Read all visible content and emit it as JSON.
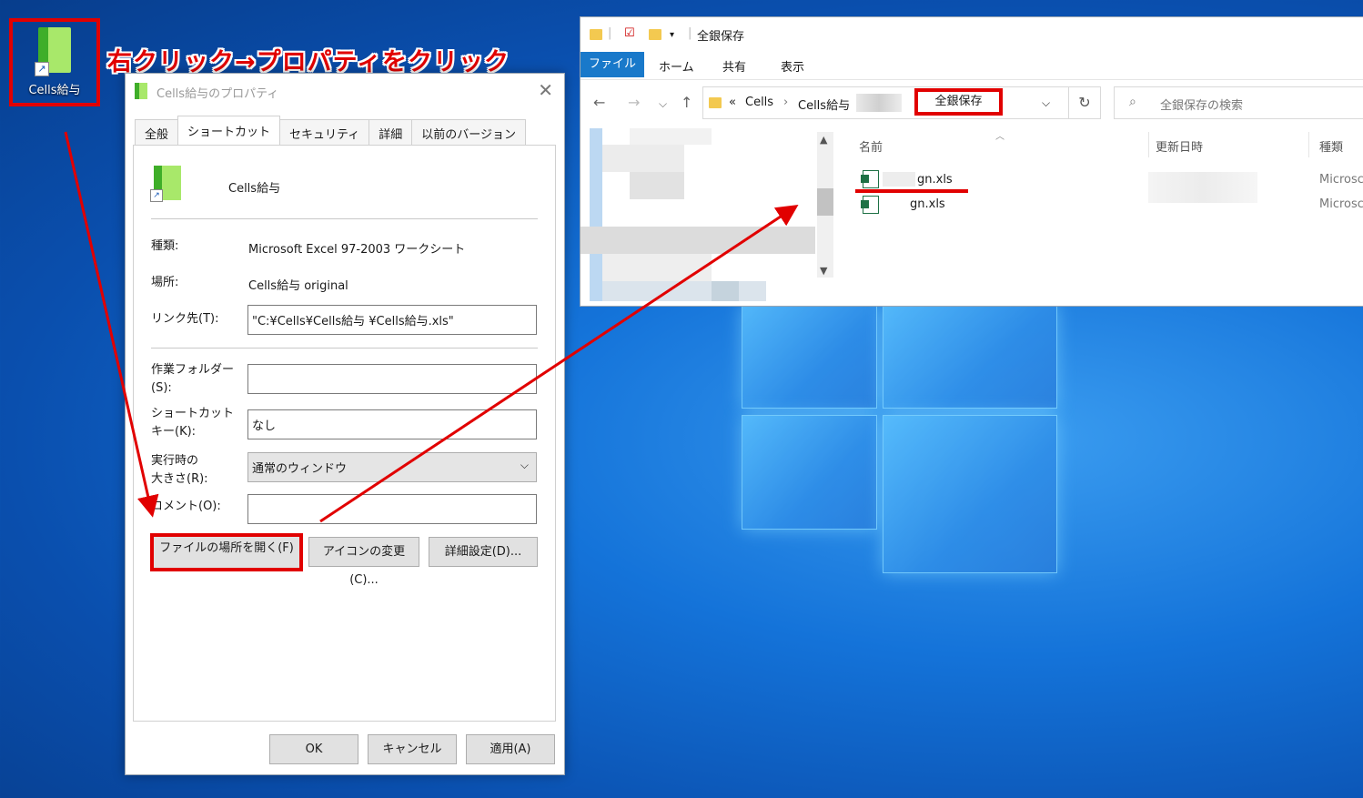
{
  "desktop": {
    "icon_label": "Cells給与",
    "instruction": "右クリック→プロパティをクリック"
  },
  "dialog": {
    "title": "Cells給与のプロパティ",
    "close_glyph": "✕",
    "tabs": [
      "全般",
      "ショートカット",
      "セキュリティ",
      "詳細",
      "以前のバージョン"
    ],
    "active_tab": "ショートカット",
    "file_name": "Cells給与",
    "rows": {
      "type_label": "種類:",
      "type_value": "Microsoft Excel 97-2003 ワークシート",
      "location_label": "場所:",
      "location_value": "Cells給与 original",
      "target_label": "リンク先(T):",
      "target_value": "\"C:¥Cells¥Cells給与          ¥Cells給与.xls\"",
      "workdir_label_1": "作業フォルダー",
      "workdir_label_2": "(S):",
      "workdir_value": "",
      "hotkey_label_1": "ショートカット",
      "hotkey_label_2": "キー(K):",
      "hotkey_value": "なし",
      "run_label_1": "実行時の",
      "run_label_2": "大きさ(R):",
      "run_value": "通常のウィンドウ",
      "comment_label": "コメント(O):",
      "comment_value": ""
    },
    "buttons": {
      "open_location": "ファイルの場所を開く(F)",
      "change_icon": "アイコンの変更(C)...",
      "advanced": "詳細設定(D)...",
      "ok": "OK",
      "cancel": "キャンセル",
      "apply": "適用(A)"
    }
  },
  "explorer": {
    "title": "全銀保存",
    "ribbon": {
      "file": "ファイル",
      "home": "ホーム",
      "share": "共有",
      "view": "表示"
    },
    "address": {
      "chevrons": "«",
      "seg1": "Cells",
      "sep": "›",
      "seg2": "Cells給与",
      "current": "全銀保存"
    },
    "search_placeholder": "全銀保存の検索",
    "columns": {
      "name": "名前",
      "modified": "更新日時",
      "type": "種類"
    },
    "files": [
      {
        "name": "gn.xls",
        "type": "Microsc"
      },
      {
        "name": "gn.xls",
        "type": "Microsc"
      }
    ]
  },
  "colors": {
    "highlight_red": "#e10000",
    "ribbon_blue": "#1979ca"
  }
}
